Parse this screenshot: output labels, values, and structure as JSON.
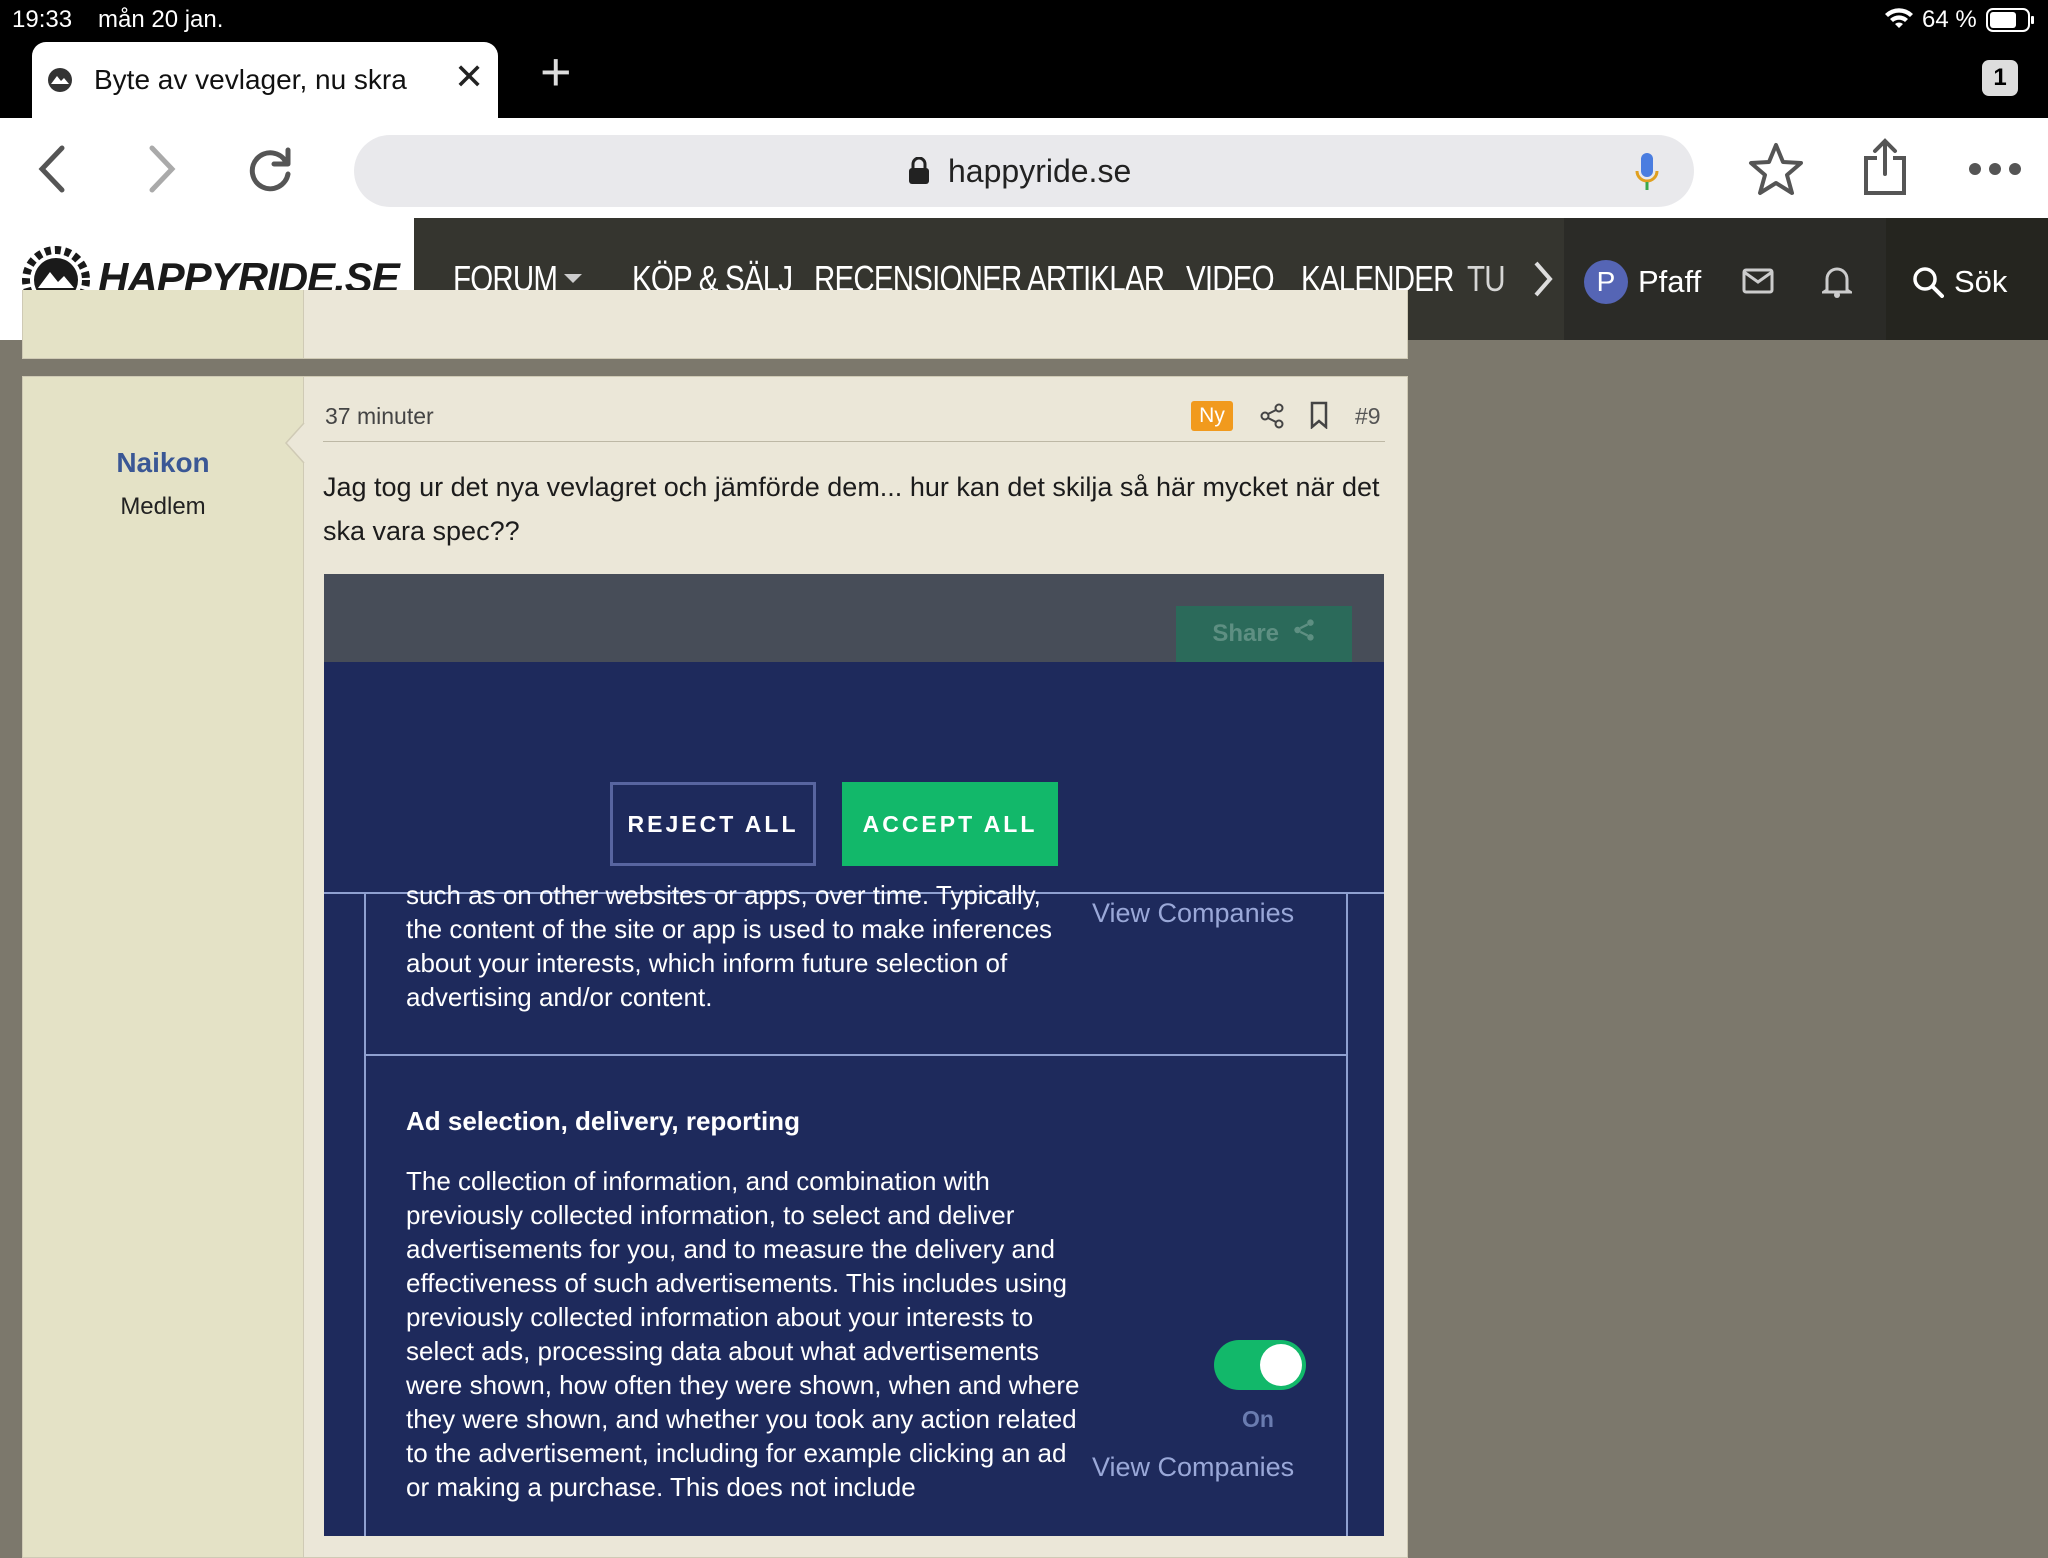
{
  "status_bar": {
    "time": "19:33",
    "date": "mån 20 jan.",
    "battery": "64 %"
  },
  "browser": {
    "tab_title": "Byte av vevlager, nu skra",
    "tab_count": "1",
    "url": "happyride.se",
    "icons": [
      "back-icon",
      "forward-icon",
      "reload-icon",
      "lock-icon",
      "mic-icon",
      "star-icon",
      "share-icon",
      "more-icon"
    ]
  },
  "site_nav": {
    "logo": "HAPPYRIDE.SE",
    "items": [
      "FORUM",
      "KÖP & SÄLJ",
      "RECENSIONER",
      "ARTIKLAR",
      "VIDEO",
      "KALENDER",
      "TU"
    ],
    "user_initial": "P",
    "user_name": "Pfaff",
    "search_label": "Sök",
    "active_color": "#4aa878"
  },
  "post": {
    "username": "Naikon",
    "user_title": "Medlem",
    "time": "37 minuter",
    "badge": "Ny",
    "number": "#9",
    "text": "Jag tog ur det nya vevlagret och jämförde dem... hur kan det skilja så här mycket när det ska vara spec??"
  },
  "consent": {
    "share_label": "Share",
    "reject_label": "REJECT ALL",
    "accept_label": "ACCEPT ALL",
    "accent_color": "#12b86a",
    "purpose1_text": "such as on other websites or apps, over time. Typically, the content of the site or app is used to make inferences about your interests, which inform future selection of advertising and/or content.",
    "purpose1_link": "View Companies",
    "purpose2_title": "Ad selection, delivery, reporting",
    "purpose2_text": "The collection of information, and combination with previously collected information, to select and deliver advertisements for you, and to measure the delivery and effectiveness of such advertisements. This includes using previously collected information about your interests to select ads, processing data about what advertisements were shown, how often they were shown, when and where they were shown, and whether you took any action related to the advertisement, including for example clicking an ad or making a purchase. This does not include",
    "purpose2_toggle_label": "On",
    "purpose2_link": "View Companies"
  }
}
